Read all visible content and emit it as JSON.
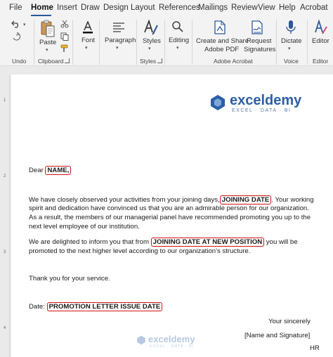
{
  "tabs": [
    "File",
    "Home",
    "Insert",
    "Draw",
    "Design",
    "Layout",
    "References",
    "Mailings",
    "Review",
    "View",
    "Help",
    "Acrobat"
  ],
  "ribbon": {
    "undo_label": "Undo",
    "paste_label": "Paste",
    "clipboard_label": "Clipboard",
    "font_label": "Font",
    "paragraph_label": "Paragraph",
    "styles_btn": "Styles",
    "styles_label": "Styles",
    "editing_label": "Editing",
    "create_share_line1": "Create and Share",
    "create_share_line2": "Adobe PDF",
    "request_line1": "Request",
    "request_line2": "Signatures",
    "adobe_label": "Adobe Acrobat",
    "dictate_btn": "Dictate",
    "voice_label": "Voice",
    "editor_btn": "Editor",
    "editor_label": "Editor"
  },
  "ruler": {
    "v_marks": [
      "1",
      "2",
      "3",
      "4"
    ]
  },
  "logo": {
    "name": "exceldemy",
    "tagline": "EXCEL · DATA · BI"
  },
  "letter": {
    "dear": "Dear",
    "name_ph": "NAME,",
    "p1_a": "We have closely observed your activities from your joining days,",
    "joining_ph": "JOINING DATE",
    "p1_b": ". Your working",
    "p1_l2": "spirit and dedication have convinced us that you are an admirable person for our organization.",
    "p1_l3": "As a result, the members of our managerial panel have recommended promoting you up to the",
    "p1_l4": "next level employee of our institution.",
    "p2_a": "We are delighted to inform you that from",
    "new_pos_ph": "JOINING DATE AT NEW POSITION",
    "p2_b": " you will be",
    "p2_l2": "promoted to the next higher level according to our organization's structure.",
    "thanks": "Thank you for your service.",
    "date_label": "Date:",
    "issue_ph": "PROMOTION LETTER ISSUE DATE",
    "sincerely": "Your sincerely",
    "name_sig": "[Name and Signature]",
    "hr": "HR"
  },
  "watermark": {
    "name": "exceldemy",
    "tagline": "EXCEL · DATA · BI"
  },
  "colors": {
    "accent": "#2b579a",
    "placeholder_border": "#d01414",
    "logo": "#2c5fa8"
  }
}
